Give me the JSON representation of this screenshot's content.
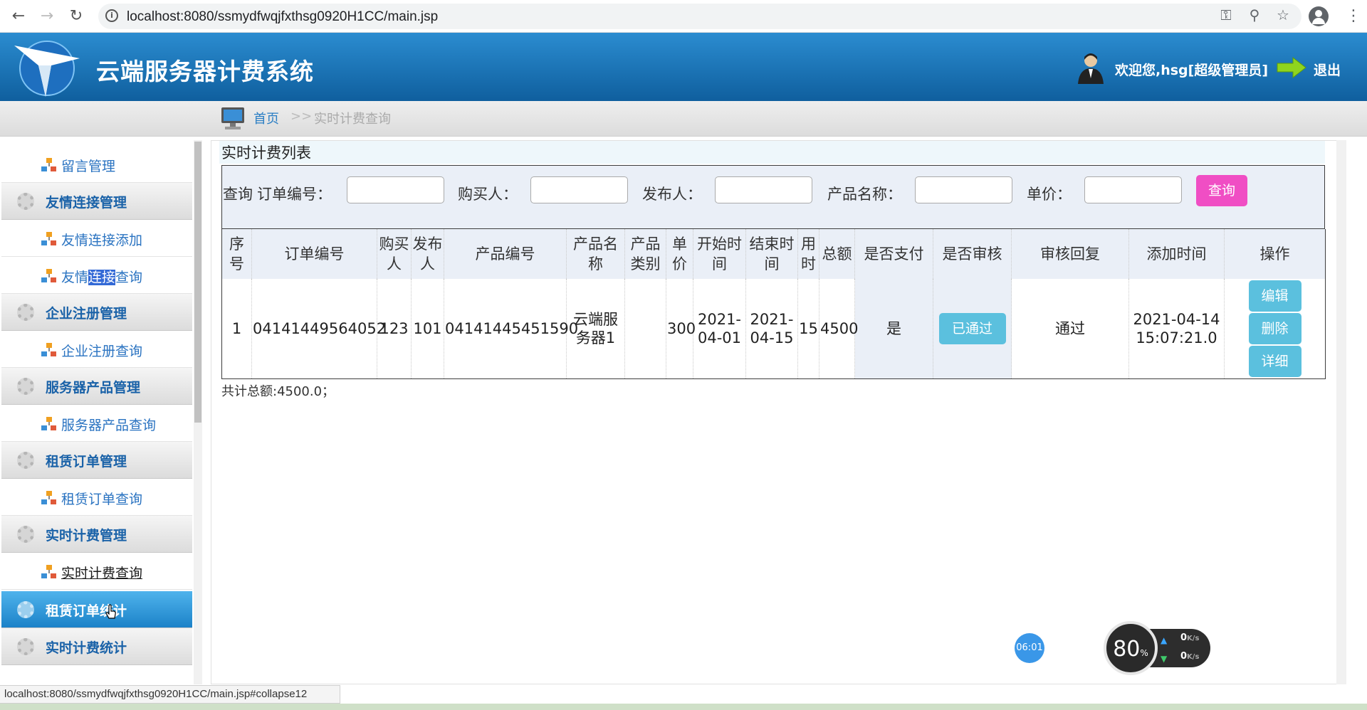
{
  "browser": {
    "url": "localhost:8080/ssmydfwqjfxthsg0920H1CC/main.jsp",
    "status_url": "localhost:8080/ssmydfwqjfxthsg0920H1CC/main.jsp#collapse12"
  },
  "header": {
    "title": "云端服务器计费系统",
    "welcome": "欢迎您,hsg[超级管理员]",
    "logout": "退出"
  },
  "breadcrumb": {
    "home": "首页",
    "separator": ">>",
    "current": "实时计费查询"
  },
  "sidebar": {
    "items": [
      {
        "type": "sub",
        "label": "留言管理"
      },
      {
        "type": "group",
        "label": "友情连接管理"
      },
      {
        "type": "sub",
        "label": "友情连接添加"
      },
      {
        "type": "sub",
        "label_before": "友情",
        "label_selected": "连接",
        "label_after": "查询"
      },
      {
        "type": "group",
        "label": "企业注册管理"
      },
      {
        "type": "sub",
        "label": "企业注册查询"
      },
      {
        "type": "group",
        "label": "服务器产品管理"
      },
      {
        "type": "sub",
        "label": "服务器产品查询"
      },
      {
        "type": "group",
        "label": "租赁订单管理"
      },
      {
        "type": "sub",
        "label": "租赁订单查询"
      },
      {
        "type": "group",
        "label": "实时计费管理"
      },
      {
        "type": "sub",
        "label": "实时计费查询"
      },
      {
        "type": "group",
        "label": "租赁订单统计",
        "active": true
      },
      {
        "type": "group",
        "label": "实时计费统计"
      }
    ]
  },
  "panel": {
    "title": "实时计费列表",
    "search": {
      "prefix": "查询",
      "fields": [
        "订单编号：",
        "购买人：",
        "发布人：",
        "产品名称：",
        "单价："
      ],
      "button": "查询"
    },
    "table": {
      "headers": [
        "序\n号",
        "订单编号",
        "购买\n人",
        "发布\n人",
        "产品编号",
        "产品名\n称",
        "产品\n类别",
        "单\n价",
        "开始时\n间",
        "结束时\n间",
        "用\n时",
        "总额",
        "是否支付",
        "是否审核",
        "审核回复",
        "添加时间",
        "操作"
      ],
      "rows": [
        {
          "index": "1",
          "order_no": "04141449564052",
          "buyer": "123",
          "publisher": "101",
          "product_no": "04141445451590",
          "product_name": "云端服\n务器1",
          "category": "",
          "price": "300",
          "start": "2021-\n04-01",
          "end": "2021-\n04-15",
          "duration": "15",
          "total": "4500",
          "paid": "是",
          "audit": "已通过",
          "reply": "通过",
          "added": "2021-04-14\n15:07:21.0",
          "actions": [
            "编辑",
            "删除",
            "详细"
          ]
        }
      ]
    },
    "total_text": "共计总额:4500.0；"
  },
  "widgets": {
    "clock": "06:01",
    "percent": "80",
    "percent_unit": "%",
    "up_rate": "0",
    "down_rate": "0",
    "rate_unit": "K/s"
  }
}
